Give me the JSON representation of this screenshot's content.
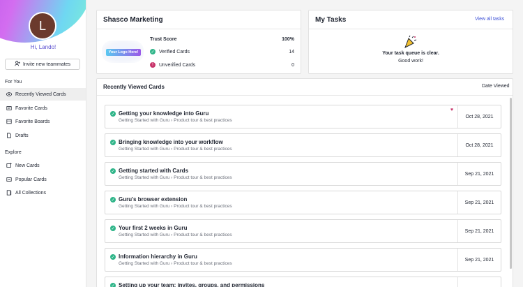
{
  "sidebar": {
    "avatar_initial": "L",
    "greeting": "Hi, Lando!",
    "invite_label": "Invite new teammates",
    "for_you_label": "For You",
    "for_you_items": [
      {
        "label": "Recently Viewed Cards",
        "icon": "eye-icon"
      },
      {
        "label": "Favorite Cards",
        "icon": "card-icon"
      },
      {
        "label": "Favorite Boards",
        "icon": "board-icon"
      },
      {
        "label": "Drafts",
        "icon": "drafts-icon"
      }
    ],
    "explore_label": "Explore",
    "explore_items": [
      {
        "label": "New Cards",
        "icon": "new-card-icon"
      },
      {
        "label": "Popular Cards",
        "icon": "popular-icon"
      },
      {
        "label": "All Collections",
        "icon": "collections-icon"
      }
    ]
  },
  "marketing": {
    "title": "Shasco Marketing",
    "logo_text": "Your Logo Here!",
    "trust_label": "Trust Score",
    "trust_value": "100%",
    "verified_label": "Verified Cards",
    "verified_value": "14",
    "unverified_label": "Unverified Cards",
    "unverified_value": "0"
  },
  "tasks": {
    "title": "My Tasks",
    "view_all": "View all tasks",
    "line1": "Your task queue is clear.",
    "line2": "Good work!"
  },
  "recent": {
    "title": "Recently Viewed Cards",
    "date_header": "Date Viewed",
    "cards": [
      {
        "title": "Getting your knowledge into Guru",
        "collection": "Getting Started with Guru",
        "board": "Product tour & best practices",
        "date": "Oct 28, 2021",
        "favorite": true
      },
      {
        "title": "Bringing knowledge into your workflow",
        "collection": "Getting Started with Guru",
        "board": "Product tour & best practices",
        "date": "Oct 28, 2021",
        "favorite": false
      },
      {
        "title": "Getting started with Cards",
        "collection": "Getting Started with Guru",
        "board": "Product tour & best practices",
        "date": "Sep 21, 2021",
        "favorite": false
      },
      {
        "title": "Guru's browser extension",
        "collection": "Getting Started with Guru",
        "board": "Product tour & best practices",
        "date": "Sep 21, 2021",
        "favorite": false
      },
      {
        "title": "Your first 2 weeks in Guru",
        "collection": "Getting Started with Guru",
        "board": "Product tour & best practices",
        "date": "Sep 21, 2021",
        "favorite": false
      },
      {
        "title": "Information hierarchy in Guru",
        "collection": "Getting Started with Guru",
        "board": "Product tour & best practices",
        "date": "Sep 21, 2021",
        "favorite": false
      },
      {
        "title": "Setting up your team: invites, groups, and permissions",
        "collection": "",
        "board": "",
        "date": "",
        "favorite": false
      }
    ]
  },
  "colors": {
    "accent": "#3b4fd6",
    "verified": "#2fb589",
    "unverified": "#c8346a"
  }
}
